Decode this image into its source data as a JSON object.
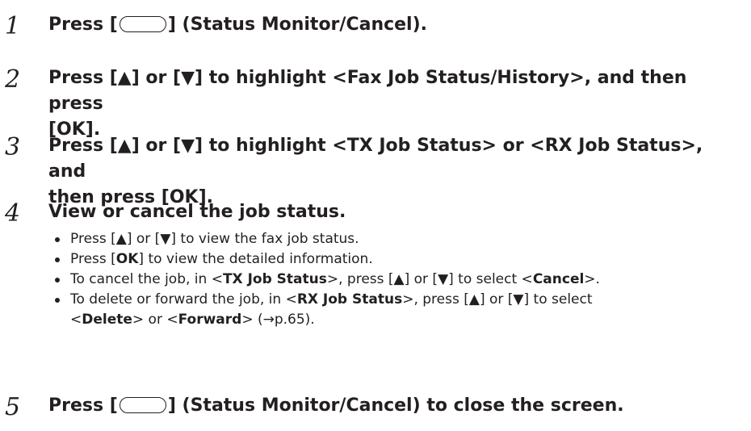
{
  "steps": [
    {
      "number": "1",
      "pre": "Press [",
      "post": "] (Status Monitor/Cancel)."
    },
    {
      "number": "2",
      "line1": "Press [▲] or [▼] to highlight <Fax Job Status/History>, and then press",
      "line2": "[OK]."
    },
    {
      "number": "3",
      "line1": "Press [▲] or [▼] to highlight <TX Job Status> or <RX Job Status>, and",
      "line2": "then press [OK]."
    },
    {
      "number": "4",
      "title": "View or cancel the job status.",
      "bullets": {
        "b1": "Press [▲] or [▼] to view the fax job status.",
        "b2_pre": "Press [",
        "b2_bold": "OK",
        "b2_post": "] to view the detailed information.",
        "b3_pre": "To cancel the job, in <",
        "b3_bold1": "TX Job Status",
        "b3_mid": ">, press [▲] or [▼] to select <",
        "b3_bold2": "Cancel",
        "b3_post": ">.",
        "b4_pre": "To delete or forward the job, in <",
        "b4_bold1": "RX Job Status",
        "b4_mid": ">, press [▲] or [▼] to select",
        "b4_l2_pre": "<",
        "b4_bold2": "Delete",
        "b4_l2_mid": "> or <",
        "b4_bold3": "Forward",
        "b4_l2_post": "> (→p.65)."
      }
    },
    {
      "number": "5",
      "pre": "Press [",
      "post": "] (Status Monitor/Cancel) to close the screen."
    }
  ]
}
